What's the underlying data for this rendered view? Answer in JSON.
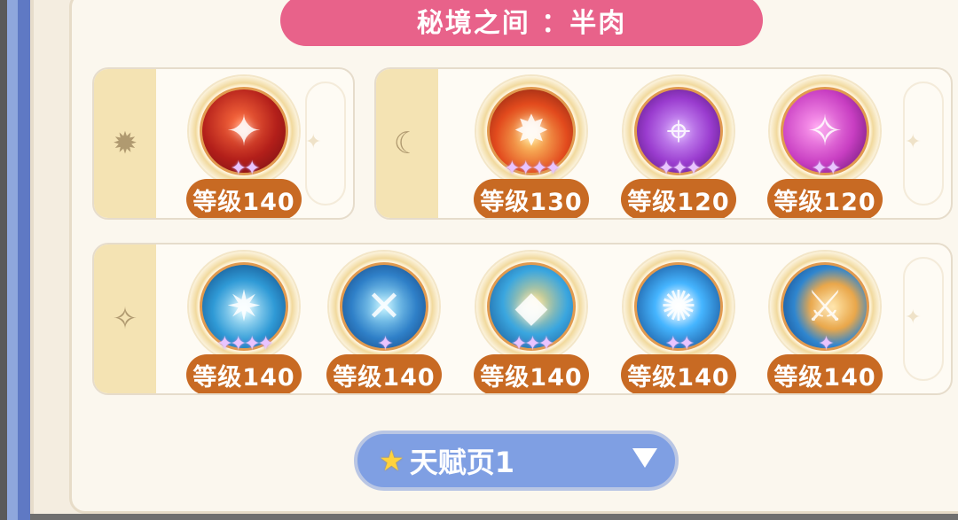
{
  "title": "秘境之间 ：半肉",
  "rows": [
    {
      "groups": [
        {
          "tab_icon": "sun-icon",
          "tab_glyph": "✹",
          "skills": [
            {
              "level": "等级140",
              "stars": 2,
              "glyph": "✦",
              "theme": "fire-a"
            }
          ]
        },
        {
          "tab_icon": "moon-icon",
          "tab_glyph": "☾",
          "skills": [
            {
              "level": "等级130",
              "stars": 4,
              "glyph": "✸",
              "theme": "fire-b"
            },
            {
              "level": "等级120",
              "stars": 3,
              "glyph": "⌖",
              "theme": "arcane-a"
            },
            {
              "level": "等级120",
              "stars": 2,
              "glyph": "✧",
              "theme": "arcane-b"
            }
          ]
        }
      ]
    },
    {
      "groups": [
        {
          "tab_icon": "star-sparkle-icon",
          "tab_glyph": "✧",
          "skills": [
            {
              "level": "等级140",
              "stars": 4,
              "glyph": "✷",
              "theme": "ice-a"
            },
            {
              "level": "等级140",
              "stars": 1,
              "glyph": "✕",
              "theme": "ice-b"
            },
            {
              "level": "等级140",
              "stars": 3,
              "glyph": "◆",
              "theme": "ice-c"
            },
            {
              "level": "等级140",
              "stars": 2,
              "glyph": "✺",
              "theme": "ice-d"
            },
            {
              "level": "等级140",
              "stars": 1,
              "glyph": "⚔",
              "theme": "ice-e"
            }
          ]
        }
      ]
    }
  ],
  "talent_page": {
    "label": "天赋页1",
    "star_icon": "star-icon",
    "chevron_icon": "chevron-down-icon"
  }
}
